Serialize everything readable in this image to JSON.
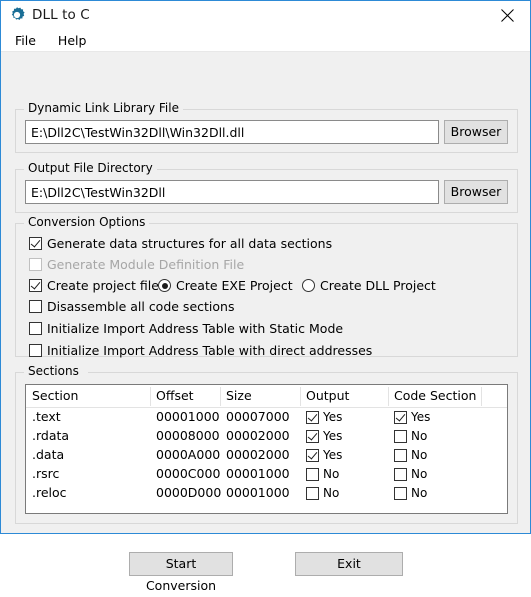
{
  "window": {
    "title": "DLL to C",
    "app_icon": "gear-icon",
    "close_icon": "close-icon",
    "border_color": "#2d8ad6",
    "icon_color": "#1a6e96"
  },
  "menubar": {
    "items": [
      {
        "label": "File"
      },
      {
        "label": "Help"
      }
    ]
  },
  "dll_group": {
    "legend": "Dynamic Link Library File",
    "input_value": "E:\\Dll2C\\TestWin32Dll\\Win32Dll.dll",
    "input_placeholder": "",
    "browse_label": "Browser"
  },
  "output_group": {
    "legend": "Output File Directory",
    "input_value": "E:\\Dll2C\\TestWin32Dll",
    "input_placeholder": "",
    "browse_label": "Browser"
  },
  "conversion_group": {
    "legend": "Conversion Options",
    "options": [
      {
        "label": "Generate data structures for all data sections",
        "checked": true,
        "disabled": false
      },
      {
        "label": "Generate Module Definition File",
        "checked": false,
        "disabled": true
      },
      {
        "label": "Create project files",
        "checked": true,
        "disabled": false
      },
      {
        "label": "Disassemble all code sections",
        "checked": false,
        "disabled": false
      },
      {
        "label": "Initialize Import Address Table with Static Mode",
        "checked": false,
        "disabled": false
      },
      {
        "label": "Initialize Import Address Table with direct addresses",
        "checked": false,
        "disabled": false
      }
    ],
    "project_type": [
      {
        "label": "Create EXE Project",
        "selected": true
      },
      {
        "label": "Create DLL Project",
        "selected": false
      }
    ]
  },
  "sections_group": {
    "legend": "Sections",
    "columns": [
      "Section",
      "Offset",
      "Size",
      "Output",
      "Code Section",
      ""
    ],
    "rows": [
      {
        "section": ".text",
        "offset": "00001000",
        "size": "00007000",
        "output": "Yes",
        "output_checked": true,
        "code": "Yes",
        "code_checked": true
      },
      {
        "section": ".rdata",
        "offset": "00008000",
        "size": "00002000",
        "output": "Yes",
        "output_checked": true,
        "code": "No",
        "code_checked": false
      },
      {
        "section": ".data",
        "offset": "0000A000",
        "size": "00002000",
        "output": "Yes",
        "output_checked": true,
        "code": "No",
        "code_checked": false
      },
      {
        "section": ".rsrc",
        "offset": "0000C000",
        "size": "00001000",
        "output": "No",
        "output_checked": false,
        "code": "No",
        "code_checked": false
      },
      {
        "section": ".reloc",
        "offset": "0000D000",
        "size": "00001000",
        "output": "No",
        "output_checked": false,
        "code": "No",
        "code_checked": false
      }
    ]
  },
  "actions": {
    "start_label": "Start Conversion",
    "exit_label": "Exit"
  }
}
